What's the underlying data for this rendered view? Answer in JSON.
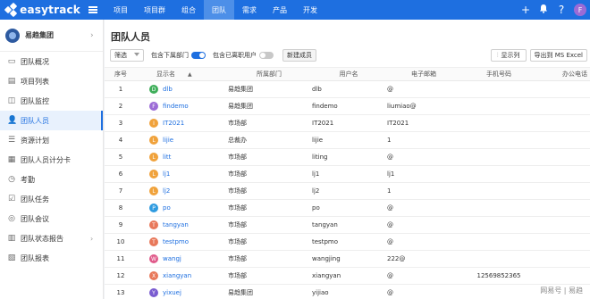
{
  "brand": {
    "name": "easytrack",
    "logo_colors": [
      "#ffffff"
    ]
  },
  "nav": [
    {
      "label": "项目",
      "active": false
    },
    {
      "label": "项目群",
      "active": false
    },
    {
      "label": "组合",
      "active": false
    },
    {
      "label": "团队",
      "active": true
    },
    {
      "label": "需求",
      "active": false
    },
    {
      "label": "产品",
      "active": false
    },
    {
      "label": "开发",
      "active": false
    }
  ],
  "top_right": {
    "plus_icon": "+",
    "bell_icon": "🔔",
    "help_icon": "?",
    "avatar_letter": "F"
  },
  "sidebar": {
    "org_name": "易趋集团",
    "org_chevron": "›",
    "items": [
      {
        "label": "团队概况",
        "icon": "▭",
        "active": false
      },
      {
        "label": "项目列表",
        "icon": "▤",
        "active": false
      },
      {
        "label": "团队监控",
        "icon": "◫",
        "active": false
      },
      {
        "label": "团队人员",
        "icon": "👤",
        "active": true
      },
      {
        "label": "资源计划",
        "icon": "☰",
        "active": false
      },
      {
        "label": "团队人员计分卡",
        "icon": "▦",
        "active": false
      },
      {
        "label": "考勤",
        "icon": "◷",
        "active": false
      },
      {
        "label": "团队任务",
        "icon": "☑",
        "active": false
      },
      {
        "label": "团队会议",
        "icon": "◎",
        "active": false
      },
      {
        "label": "团队状态报告",
        "icon": "▥",
        "chevron": "›",
        "active": false
      },
      {
        "label": "团队报表",
        "icon": "▧",
        "active": false
      }
    ]
  },
  "main": {
    "title": "团队人员",
    "filter_label": "筛选",
    "include_sub_label": "包含下属部门",
    "include_sub_on": true,
    "include_left_label": "包含已离职用户",
    "include_left_on": false,
    "new_member_label": "新建成员",
    "show_columns_label": "显示列",
    "export_label": "导出到 MS Excel"
  },
  "table": {
    "headers": {
      "no": "序号",
      "name": "显示名",
      "dept": "所属部门",
      "user": "用户名",
      "mail": "电子邮箱",
      "phone": "手机号码",
      "office": "办公电话"
    },
    "sort_indicator": "▲",
    "rows": [
      {
        "no": "1",
        "av": "D",
        "color": "#3fae5a",
        "name": "dlb",
        "dept": "易趋集团",
        "user": "dlb",
        "mail": "@",
        "phone": "",
        "office": ""
      },
      {
        "no": "2",
        "av": "F",
        "color": "#9b6bd6",
        "name": "findemo",
        "dept": "易趋集团",
        "user": "findemo",
        "mail": "liumiao@",
        "phone": "",
        "office": ""
      },
      {
        "no": "3",
        "av": "I",
        "color": "#f0a23b",
        "name": "IT2021",
        "dept": "市场部",
        "user": "IT2021",
        "mail": "IT2021",
        "phone": "",
        "office": ""
      },
      {
        "no": "4",
        "av": "L",
        "color": "#f0a23b",
        "name": "lijie",
        "dept": "总裁办",
        "user": "lijie",
        "mail": "1",
        "phone": "",
        "office": ""
      },
      {
        "no": "5",
        "av": "L",
        "color": "#f0a23b",
        "name": "litt",
        "dept": "市场部",
        "user": "liting",
        "mail": "@",
        "phone": "",
        "office": ""
      },
      {
        "no": "6",
        "av": "L",
        "color": "#f0a23b",
        "name": "lj1",
        "dept": "市场部",
        "user": "lj1",
        "mail": "lj1",
        "phone": "",
        "office": ""
      },
      {
        "no": "7",
        "av": "L",
        "color": "#f0a23b",
        "name": "lj2",
        "dept": "市场部",
        "user": "lj2",
        "mail": "1",
        "phone": "",
        "office": ""
      },
      {
        "no": "8",
        "av": "P",
        "color": "#2f9be0",
        "name": "po",
        "dept": "市场部",
        "user": "po",
        "mail": "@",
        "phone": "",
        "office": ""
      },
      {
        "no": "9",
        "av": "T",
        "color": "#e8785a",
        "name": "tangyan",
        "dept": "市场部",
        "user": "tangyan",
        "mail": "@",
        "phone": "",
        "office": ""
      },
      {
        "no": "10",
        "av": "T",
        "color": "#e8785a",
        "name": "testpmo",
        "dept": "市场部",
        "user": "testpmo",
        "mail": "@",
        "phone": "",
        "office": ""
      },
      {
        "no": "11",
        "av": "W",
        "color": "#e05a8a",
        "name": "wangj",
        "dept": "市场部",
        "user": "wangjing",
        "mail": "222@",
        "phone": "",
        "office": ""
      },
      {
        "no": "12",
        "av": "X",
        "color": "#e8785a",
        "name": "xiangyan",
        "dept": "市场部",
        "user": "xiangyan",
        "mail": "@",
        "phone": "12569852365",
        "office": ""
      },
      {
        "no": "13",
        "av": "Y",
        "color": "#7a5cd0",
        "name": "yixuej",
        "dept": "易趋集团",
        "user": "yijiao",
        "mail": "@",
        "phone": "",
        "office": ""
      }
    ]
  },
  "watermark": "网易号 | 易趋"
}
